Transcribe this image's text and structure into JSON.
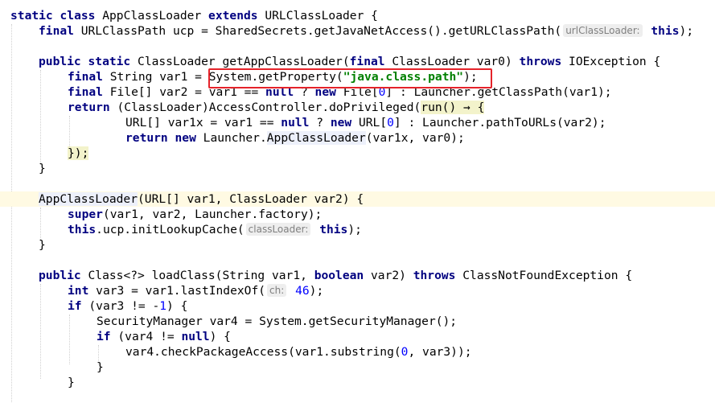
{
  "code": {
    "class_kw": "static class",
    "class_name": "AppClassLoader",
    "extends_kw": "extends",
    "super_class": "URLClassLoader {",
    "final": "final",
    "ucp_decl_type": "URLClassPath ucp = SharedSecrets.getJavaNetAccess().getURLClassPath(",
    "hint_urlClassLoader": "urlClassLoader:",
    "this": "this",
    "paren_semi": ");",
    "public_static": "public static",
    "getAppClassLoader_sig": "ClassLoader getAppClassLoader(",
    "classloader_var0": "ClassLoader var0)",
    "throws": "throws",
    "ioexception": "IOException {",
    "string_var1_eq": "String var1 = ",
    "system_getproperty": "System.getProperty(",
    "java_class_path": "\"java.class.path\"",
    "close_paren_semi": ");",
    "file_arr_var2": "File[] var2 = var1 == ",
    "null": "null",
    "ternary_q": " ? ",
    "new": "new",
    "file_zero_open": " File[",
    "zero": "0",
    "launcher_getclasspath": "] : Launcher.getClassPath(var1);",
    "return": "return",
    "access_controller": "(ClassLoader)AccessController.doPrivileged(",
    "run_lambda": "run() → {",
    "url_var1x": "URL[] var1x = var1 == ",
    "url_zero_open": " URL[",
    "launcher_pathtourls": "] : Launcher.pathToURLs(var2);",
    "launcher_new": " Launcher.",
    "appclassloader_call": "AppClassLoader",
    "var1x_var0": "(var1x, var0);",
    "lambda_close": "});",
    "brace_close": "}",
    "constructor_name": "AppClassLoader",
    "constructor_params": "(URL[] var1, ClassLoader var2) {",
    "super": "super",
    "super_args": "(var1, var2, Launcher.factory);",
    "this_ucp_init": ".ucp.initLookupCache(",
    "hint_classLoader": "classLoader:",
    "public": "public",
    "loadclass_sig": "Class<?> loadClass(String var1, ",
    "boolean": "boolean",
    "var2_close": "var2)",
    "cnf_exception": "ClassNotFoundException {",
    "int": "int",
    "var3_eq": "var3 = var1.lastIndexOf(",
    "hint_ch": "ch:",
    "num_46": "46",
    "if": "if",
    "if_var3": "(var3 != -",
    "num_1": "1",
    "if_var3_close": ") {",
    "secmgr_line": "SecurityManager var4 = System.getSecurityManager();",
    "if_var4": "(var4 != ",
    "if_var4_close": ") {",
    "checkpkg": "var4.checkPackageAccess(var1.substring(",
    "checkpkg_rest": ", var3));",
    "brace_open_close": "}"
  },
  "colors": {
    "keyword": "#000080",
    "string": "#008000",
    "number": "#0000ff",
    "highlight_line": "#fffae3",
    "callout_border": "#e5232a",
    "hint_background": "#eeeeee"
  }
}
